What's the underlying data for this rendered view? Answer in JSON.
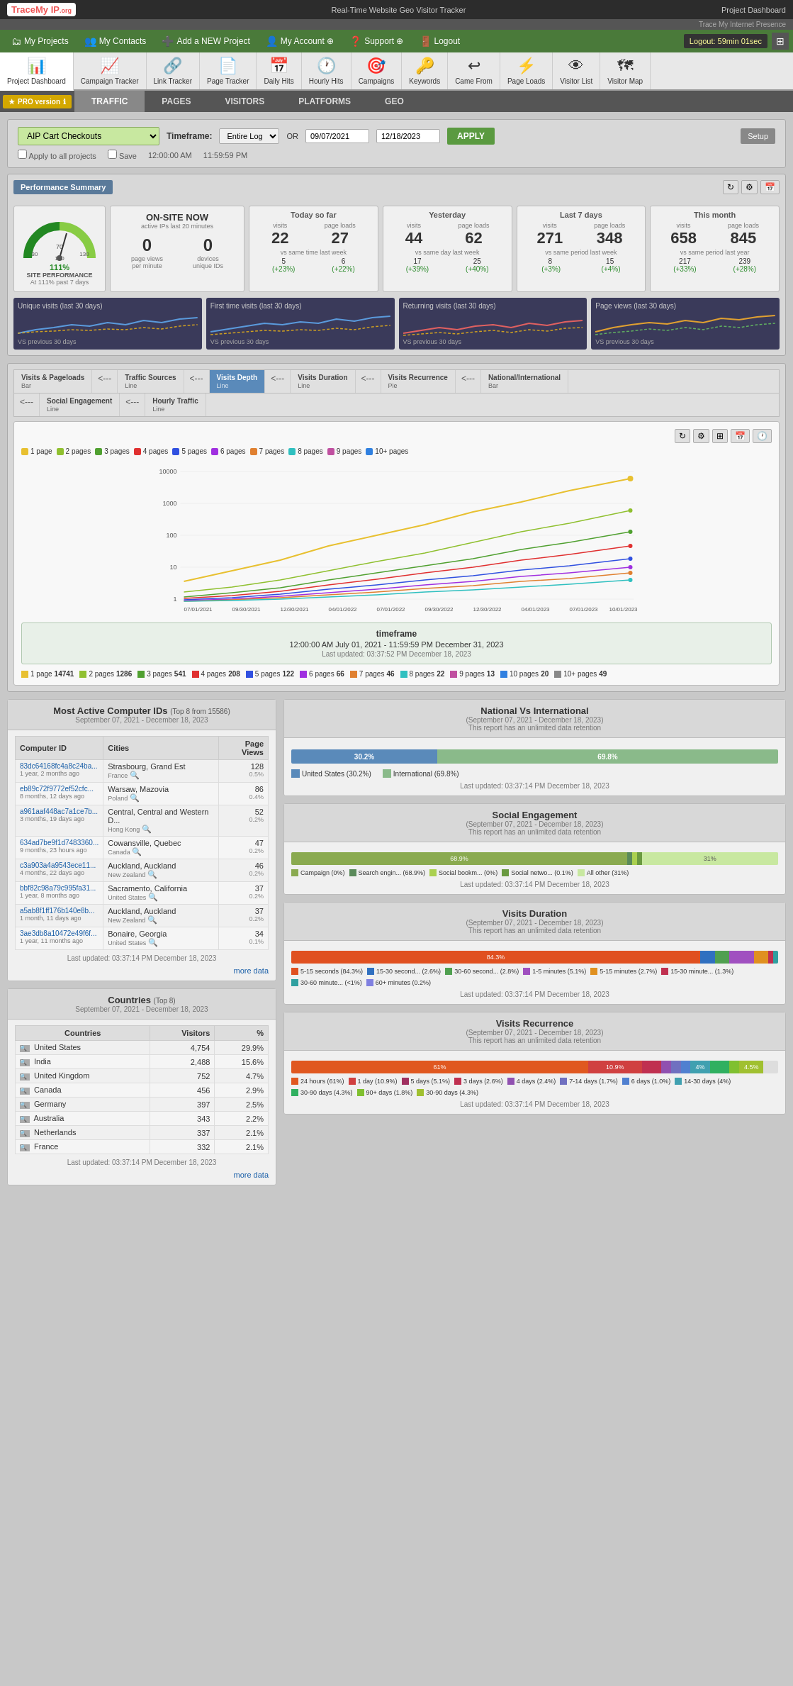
{
  "header": {
    "logo": "TraceMy IP.org",
    "tagline": "Real-Time Website Geo Visitor Tracker",
    "project": "Project Dashboard",
    "trace_label": "Trace My Internet Presence"
  },
  "nav": {
    "items": [
      {
        "label": "My Projects",
        "icon": "🗂"
      },
      {
        "label": "My Contacts",
        "icon": "👥"
      },
      {
        "label": "Add a NEW Project",
        "icon": "➕"
      },
      {
        "label": "My Account ⊕",
        "icon": "👤"
      },
      {
        "label": "Support ⊕",
        "icon": "❓"
      },
      {
        "label": "Logout",
        "icon": "🚪"
      }
    ],
    "session": "Logout: 59min 01sec"
  },
  "toolbar": {
    "items": [
      {
        "label": "Project Dashboard",
        "icon": "📊",
        "active": true
      },
      {
        "label": "Campaign Tracker",
        "icon": "📈"
      },
      {
        "label": "Link Tracker",
        "icon": "🔗"
      },
      {
        "label": "Page Tracker",
        "icon": "📄"
      },
      {
        "label": "Daily Hits",
        "icon": "📅"
      },
      {
        "label": "Hourly Hits",
        "icon": "🕐"
      },
      {
        "label": "Campaigns",
        "icon": "🎯"
      },
      {
        "label": "Keywords",
        "icon": "🔑"
      },
      {
        "label": "Came From",
        "icon": "↩"
      },
      {
        "label": "Page Loads",
        "icon": "⚡"
      },
      {
        "label": "Visitor List",
        "icon": "👁"
      },
      {
        "label": "Visitor Map",
        "icon": "🗺"
      }
    ]
  },
  "main_tabs": [
    "TRAFFIC",
    "PAGES",
    "VISITORS",
    "PLATFORMS",
    "GEO"
  ],
  "active_main_tab": "TRAFFIC",
  "project_selector": {
    "value": "AIP Cart Checkouts",
    "placeholder": "Select project"
  },
  "timeframe": {
    "label": "Timeframe:",
    "select_value": "Entire Log",
    "or_label": "OR",
    "start_date": "09/07/2021",
    "end_date": "12/18/2023",
    "apply_label": "APPLY",
    "setup_label": "Setup",
    "apply_all_label": "Apply to all projects",
    "save_label": "Save",
    "start_time": "12:00:00 AM",
    "end_time": "11:59:59 PM"
  },
  "perf_summary": {
    "title": "Performance Summary",
    "onsite": {
      "title": "ON-SITE NOW",
      "subtitle": "active IPs last 20 minutes",
      "page_views_label": "page views",
      "page_views_val": "0",
      "per_minute_label": "per minute",
      "devices_label": "devices",
      "devices_val": "0",
      "unique_ids_label": "unique IDs"
    },
    "today": {
      "title": "Today so far",
      "visits_label": "visits",
      "visits_val": "22",
      "page_loads_label": "page loads",
      "page_loads_val": "27",
      "vs_label": "vs same time last week",
      "vs_visits": "5",
      "vs_visits_pct": "(+23%)",
      "vs_loads": "6",
      "vs_loads_pct": "(+22%)"
    },
    "yesterday": {
      "title": "Yesterday",
      "visits_val": "44",
      "page_loads_val": "62",
      "vs_label": "vs same day last week",
      "vs_visits": "17",
      "vs_visits_pct": "(+39%)",
      "vs_loads": "25",
      "vs_loads_pct": "(+40%)"
    },
    "last7": {
      "title": "Last 7 days",
      "visits_val": "271",
      "page_loads_val": "348",
      "vs_label": "vs same period last week",
      "vs_visits": "8",
      "vs_visits_pct": "(+3%)",
      "vs_loads": "15",
      "vs_loads_pct": "(+4%)"
    },
    "this_month": {
      "title": "This month",
      "visits_val": "658",
      "page_loads_val": "845",
      "vs_label": "vs same period last year",
      "vs_visits": "217",
      "vs_visits_pct": "(+33%)",
      "vs_loads": "239",
      "vs_loads_pct": "(+28%)"
    },
    "gauge": {
      "pct": "111%",
      "label": "SITE PERFORMANCE",
      "sub": "At 111% past 7 days"
    }
  },
  "sparklines": [
    {
      "title": "Unique visits (last 30 days)",
      "sub": "VS previous 30 days"
    },
    {
      "title": "First time visits (last 30 days)",
      "sub": "VS previous 30 days"
    },
    {
      "title": "Returning visits (last 30 days)",
      "sub": "VS previous 30 days"
    },
    {
      "title": "Page views (last 30 days)",
      "sub": "VS previous 30 days"
    }
  ],
  "sub_tabs": [
    {
      "label": "Visits & Pageloads",
      "sub": "Bar",
      "active": false
    },
    {
      "label": "Traffic Sources",
      "sub": "Line",
      "active": false
    },
    {
      "label": "Visits Depth",
      "sub": "Line",
      "active": true
    },
    {
      "label": "Visits Duration",
      "sub": "Line",
      "active": false
    },
    {
      "label": "Visits Recurrence",
      "sub": "Pie",
      "active": false
    },
    {
      "label": "National/International",
      "sub": "Bar",
      "active": false
    },
    {
      "label": "Social Engagement",
      "sub": "Line",
      "active": false
    },
    {
      "label": "Hourly Traffic",
      "sub": "Line",
      "active": false
    }
  ],
  "chart": {
    "title": "Visits Depth Line",
    "legend_colors": [
      "#e8c030",
      "#90c030",
      "#50a030",
      "#e03030",
      "#3050e0",
      "#a030e0",
      "#e08030",
      "#30c0c0",
      "#c050a0",
      "#3080e0"
    ],
    "legend_labels": [
      "1 page",
      "2 pages",
      "3 pages",
      "4 pages",
      "5 pages",
      "6 pages",
      "7 pages",
      "8 pages",
      "9 pages",
      "10+ pages"
    ],
    "x_labels": [
      "07/01/2021",
      "09/30/2021",
      "12/30/2021",
      "04/01/2022",
      "07/01/2022",
      "09/30/2022",
      "12/30/2022",
      "04/01/2023",
      "07/01/2023",
      "10/01/2023"
    ],
    "y_labels": [
      "10000",
      "1000",
      "100",
      "10",
      "1"
    ],
    "timeframe_title": "timeframe",
    "timeframe_range": "12:00:00 AM July 01, 2021 - 11:59:59 PM December 31, 2023",
    "last_updated": "Last updated: 03:37:52 PM December 18, 2023",
    "data_items": [
      {
        "label": "1 page",
        "value": "14741",
        "color": "#e8c030"
      },
      {
        "label": "2 pages",
        "value": "1286",
        "color": "#90c030"
      },
      {
        "label": "3 pages",
        "value": "541",
        "color": "#50a030"
      },
      {
        "label": "4 pages",
        "value": "208",
        "color": "#e03030"
      },
      {
        "label": "5 pages",
        "value": "122",
        "color": "#3050e0"
      },
      {
        "label": "6 pages",
        "value": "66",
        "color": "#a030e0"
      },
      {
        "label": "7 pages",
        "value": "46",
        "color": "#e08030"
      },
      {
        "label": "8 pages",
        "value": "22",
        "color": "#30c0c0"
      },
      {
        "label": "9 pages",
        "value": "13",
        "color": "#c050a0"
      },
      {
        "label": "10 pages",
        "value": "20",
        "color": "#3080e0"
      },
      {
        "label": "10+ pages",
        "value": "49",
        "color": "#888888"
      }
    ]
  },
  "most_active": {
    "title": "Most Active Computer IDs",
    "subtitle": "Top 8 from 15586",
    "date_range": "September 07, 2021 - December 18, 2023",
    "cols": [
      "Computer ID",
      "Cities",
      "Page Views"
    ],
    "rows": [
      {
        "id": "83dc64168fc4a8c24ba...",
        "meta": "1 year, 2 months ago",
        "city": "Strasbourg, Grand Est",
        "city2": "France",
        "views": "128",
        "pct": "0.5%"
      },
      {
        "id": "eb89c72f9772ef52cfc...",
        "meta": "8 months, 12 days ago",
        "city": "Warsaw, Mazovia",
        "city2": "Poland",
        "views": "86",
        "pct": "0.4%"
      },
      {
        "id": "a961aaf448ac7a1ce7b...",
        "meta": "3 months, 19 days ago",
        "city": "Central, Central and Western D...",
        "city2": "Hong Kong",
        "views": "52",
        "pct": "0.2%"
      },
      {
        "id": "634ad7be9f1d7483360...",
        "meta": "9 months, 23 hours ago",
        "city": "Cowansville, Quebec",
        "city2": "Canada",
        "views": "47",
        "pct": "0.2%"
      },
      {
        "id": "c3a903a4a9543ece11...",
        "meta": "4 months, 22 days ago",
        "city": "Auckland, Auckland",
        "city2": "New Zealand",
        "views": "46",
        "pct": "0.2%"
      },
      {
        "id": "bbf82c98a79c995fa31...",
        "meta": "1 year, 8 months ago",
        "city": "Sacramento, California",
        "city2": "United States",
        "views": "37",
        "pct": "0.2%"
      },
      {
        "id": "a5ab8f1ff176b140e8b...",
        "meta": "1 month, 11 days ago",
        "city": "Auckland, Auckland",
        "city2": "New Zealand",
        "views": "37",
        "pct": "0.2%"
      },
      {
        "id": "3ae3db8a10472e49f6f...",
        "meta": "1 year, 11 months ago",
        "city": "Bonaire, Georgia",
        "city2": "United States",
        "views": "34",
        "pct": "0.1%"
      }
    ],
    "last_updated": "Last updated: 03:37:14 PM December 18, 2023",
    "more_label": "more data"
  },
  "countries": {
    "title": "Countries",
    "subtitle": "Top 8",
    "date_range": "September 07, 2021 - December 18, 2023",
    "cols": [
      "Countries",
      "Visitors",
      "%"
    ],
    "rows": [
      {
        "name": "United States",
        "visitors": "4,754",
        "pct": "29.9%"
      },
      {
        "name": "India",
        "visitors": "2,488",
        "pct": "15.6%"
      },
      {
        "name": "United Kingdom",
        "visitors": "752",
        "pct": "4.7%"
      },
      {
        "name": "Canada",
        "visitors": "456",
        "pct": "2.9%"
      },
      {
        "name": "Germany",
        "visitors": "397",
        "pct": "2.5%"
      },
      {
        "name": "Australia",
        "visitors": "343",
        "pct": "2.2%"
      },
      {
        "name": "Netherlands",
        "visitors": "337",
        "pct": "2.1%"
      },
      {
        "name": "France",
        "visitors": "332",
        "pct": "2.1%"
      }
    ],
    "last_updated": "Last updated: 03:37:14 PM December 18, 2023",
    "more_label": "more data"
  },
  "national_vs_international": {
    "title": "National Vs International",
    "date_range": "September 07, 2021 - December 18, 2023",
    "retention_note": "This report has an unlimited data retention",
    "us_pct": "30.2%",
    "intl_pct": "69.8%",
    "us_label": "United States (30.2%)",
    "intl_label": "International (69.8%)",
    "us_width": 30,
    "intl_width": 70,
    "last_updated": "Last updated: 03:37:14 PM December 18, 2023"
  },
  "social_engagement": {
    "title": "Social Engagement",
    "date_range": "September 07, 2021 - December 18, 2023",
    "retention_note": "This report has an unlimited data retention",
    "segments": [
      {
        "label": "Campaign (0%)",
        "color": "#8aaa50",
        "width": 68,
        "text": "68.9%"
      },
      {
        "label": "Search engin... (68.9%)",
        "color": "#5a8a5a",
        "width": 20
      },
      {
        "label": "Social bookm... (0%)",
        "color": "#aad050",
        "width": 1
      },
      {
        "label": "Social netwo... (0.1%)",
        "color": "#6a9a40",
        "width": 1
      },
      {
        "label": "All other (31%)",
        "color": "#c8e8a0",
        "width": 10,
        "text": "31%"
      }
    ],
    "labels": [
      {
        "label": "Campaign (0%)",
        "color": "#8aaa50"
      },
      {
        "label": "Search engin... (68.9%)",
        "color": "#5a8a5a"
      },
      {
        "label": "Social bookm... (0%)",
        "color": "#aad050"
      },
      {
        "label": "Social netwo... (0.1%)",
        "color": "#6a9a40"
      },
      {
        "label": "All other (31%)",
        "color": "#c8e8a0"
      }
    ],
    "last_updated": "Last updated: 03:37:14 PM December 18, 2023"
  },
  "visits_duration": {
    "title": "Visits Duration",
    "date_range": "September 07, 2021 - December 18, 2023",
    "retention_note": "This report has an unlimited data retention",
    "bar_pct": "84.3%",
    "segments": [
      {
        "label": "5-15 seconds (84.3%)",
        "color": "#e05020",
        "width": 84
      },
      {
        "label": "15-30 second... (2.6%)",
        "color": "#3070c0",
        "width": 3
      },
      {
        "label": "30-60 second... (2.8%)",
        "color": "#50a050",
        "width": 3
      },
      {
        "label": "1-5 minutes (5.1%)",
        "color": "#a050c0",
        "width": 5
      },
      {
        "label": "5-15 minutes (2.7%)",
        "color": "#e09020",
        "width": 3
      },
      {
        "label": "15-30 minute... (1.3%)",
        "color": "#c03050",
        "width": 1
      },
      {
        "label": "30-60 minute... (<1%)",
        "color": "#30a0a0",
        "width": 1
      },
      {
        "label": "60+ minutes (0.2%)",
        "color": "#8080e0",
        "width": 1
      }
    ],
    "last_updated": "Last updated: 03:37:14 PM December 18, 2023"
  },
  "visits_recurrence": {
    "title": "Visits Recurrence",
    "date_range": "September 07, 2021 - December 18, 2023",
    "retention_note": "This report has an unlimited data retention",
    "segments": [
      {
        "label": "24 hours (61%)",
        "color": "#e05820",
        "width": 61
      },
      {
        "label": "1 day (10.9%)",
        "color": "#d04040",
        "width": 11
      },
      {
        "label": "5 days (5.1%)",
        "color": "#a03060",
        "width": 5
      },
      {
        "label": "3 days (2.6%)",
        "color": "#c03050",
        "width": 3
      },
      {
        "label": "4 days (2.4%)",
        "color": "#9050b0",
        "width": 2
      },
      {
        "label": "7-14 days (1.7%)",
        "color": "#7070c0",
        "width": 2
      },
      {
        "label": "6 days (1.0%)",
        "color": "#5080d0",
        "width": 1
      },
      {
        "label": "14-30 days (4%)",
        "color": "#40a0b0",
        "width": 4
      },
      {
        "label": "30-90 days (4.3%)",
        "color": "#30b060",
        "width": 4
      },
      {
        "label": "90+ days (1.8%)",
        "color": "#80c030",
        "width": 2
      },
      {
        "label": "30-90 days (4.3%)",
        "color": "#a0c030",
        "width": 4
      }
    ],
    "bar_segments": [
      {
        "label": "61%",
        "color": "#e05820",
        "width": 61
      },
      {
        "label": "10.9%",
        "color": "#d04040",
        "width": 11
      },
      {
        "label": "",
        "color": "#c03050",
        "width": 5
      },
      {
        "label": "",
        "color": "#9050b0",
        "width": 4
      },
      {
        "label": "",
        "color": "#7070c0",
        "width": 4
      },
      {
        "label": "",
        "color": "#5080d0",
        "width": 15
      }
    ],
    "labels": [
      {
        "label": "24 hours (61%)",
        "color": "#e05820"
      },
      {
        "label": "1 day (10.9%)",
        "color": "#d04040"
      },
      {
        "label": "5 days (5.1%)",
        "color": "#a03060"
      },
      {
        "label": "3 days (2.6%)",
        "color": "#c03050"
      },
      {
        "label": "4 days (2.4%)",
        "color": "#9050b0"
      },
      {
        "label": "7-14 days (1.7%)",
        "color": "#7070c0"
      },
      {
        "label": "6 days (1.0%)",
        "color": "#5080d0"
      },
      {
        "label": "14-30 days (4%)",
        "color": "#40a0b0"
      },
      {
        "label": "30-90 days (4.3%)",
        "color": "#30b060"
      },
      {
        "label": "90+ days (1.8%)",
        "color": "#80c030"
      },
      {
        "label": "30-90 days (4.3%)",
        "color": "#a0c030"
      }
    ],
    "last_updated": "Last updated: 03:37:14 PM December 18, 2023"
  }
}
